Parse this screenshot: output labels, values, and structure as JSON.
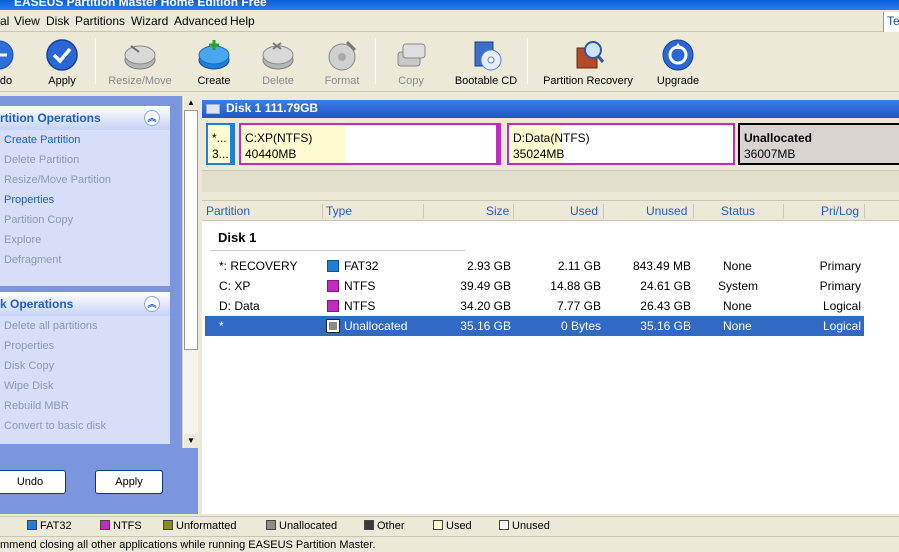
{
  "window": {
    "title": "EASEUS Partition Master Home Edition Free"
  },
  "menu": {
    "items": [
      "al",
      "View",
      "Disk",
      "Partitions",
      "Wizard",
      "Advanced",
      "Help"
    ],
    "right_tab": "Te"
  },
  "toolbar": {
    "buttons": [
      {
        "label": "do",
        "icon": "undo-icon",
        "enabled": true
      },
      {
        "label": "Apply",
        "icon": "apply-check-icon",
        "enabled": true
      },
      {
        "label": "Resize/Move",
        "icon": "resize-move-icon",
        "enabled": false
      },
      {
        "label": "Create",
        "icon": "create-partition-icon",
        "enabled": true
      },
      {
        "label": "Delete",
        "icon": "delete-partition-icon",
        "enabled": false
      },
      {
        "label": "Format",
        "icon": "format-icon",
        "enabled": false
      },
      {
        "label": "Copy",
        "icon": "copy-icon",
        "enabled": false
      },
      {
        "label": "Bootable CD",
        "icon": "bootable-cd-icon",
        "enabled": true
      },
      {
        "label": "Partition Recovery",
        "icon": "partition-recovery-icon",
        "enabled": true
      },
      {
        "label": "Upgrade",
        "icon": "upgrade-icon",
        "enabled": true
      }
    ]
  },
  "sidebar": {
    "partition_ops": {
      "title": "rtition Operations",
      "items": [
        {
          "label": "Create Partition",
          "enabled": true
        },
        {
          "label": "Delete Partition",
          "enabled": false
        },
        {
          "label": "Resize/Move Partition",
          "enabled": false
        },
        {
          "label": "Properties",
          "enabled": true
        },
        {
          "label": "Partition Copy",
          "enabled": false
        },
        {
          "label": "Explore",
          "enabled": false
        },
        {
          "label": "Defragment",
          "enabled": false
        }
      ]
    },
    "disk_ops": {
      "title": "k Operations",
      "items": [
        {
          "label": "Delete all partitions",
          "enabled": false
        },
        {
          "label": "Properties",
          "enabled": false
        },
        {
          "label": "Disk Copy",
          "enabled": false
        },
        {
          "label": "Wipe Disk",
          "enabled": false
        },
        {
          "label": "Rebuild MBR",
          "enabled": false
        },
        {
          "label": "Convert to basic disk",
          "enabled": false
        }
      ]
    },
    "undo_label": "Undo",
    "apply_label": "Apply"
  },
  "diskmap": {
    "disk_label": "Disk 1  111.79GB",
    "segments": [
      {
        "line1": "*...",
        "line2": "3..."
      },
      {
        "line1": "C:XP(NTFS)",
        "line2": "40440MB"
      },
      {
        "line1": "D:Data(NTFS)",
        "line2": "35024MB"
      },
      {
        "line1": "Unallocated",
        "line2": "36007MB"
      }
    ]
  },
  "table": {
    "headers": [
      "Partition",
      "Type",
      "Size",
      "Used",
      "Unused",
      "Status",
      "Pri/Log"
    ],
    "group": "Disk 1",
    "rows": [
      {
        "partition": "*: RECOVERY",
        "type": "FAT32",
        "size": "2.93 GB",
        "used": "2.11 GB",
        "unused": "843.49 MB",
        "status": "None",
        "prilog": "Primary"
      },
      {
        "partition": "C: XP",
        "type": "NTFS",
        "size": "39.49 GB",
        "used": "14.88 GB",
        "unused": "24.61 GB",
        "status": "System",
        "prilog": "Primary"
      },
      {
        "partition": "D: Data",
        "type": "NTFS",
        "size": "34.20 GB",
        "used": "7.77 GB",
        "unused": "26.43 GB",
        "status": "None",
        "prilog": "Logical"
      },
      {
        "partition": "*",
        "type": "Unallocated",
        "size": "35.16 GB",
        "used": "0 Bytes",
        "unused": "35.16 GB",
        "status": "None",
        "prilog": "Logical"
      }
    ]
  },
  "legend": {
    "items": [
      {
        "label": "FAT32",
        "color": "#1f7fd6"
      },
      {
        "label": "NTFS",
        "color": "#c02cc0"
      },
      {
        "label": "Unformatted",
        "color": "#8a8a1a"
      },
      {
        "label": "Unallocated",
        "color": "#8c8c8c"
      },
      {
        "label": "Other",
        "color": "#3a3a3a"
      },
      {
        "label": "Used",
        "color": "#fffbd0"
      },
      {
        "label": "Unused",
        "color": "#ffffff"
      }
    ]
  },
  "status": {
    "text": "mmend closing all other applications while running EASEUS Partition Master."
  },
  "colors": {
    "fat32": "#1f7fd6",
    "ntfs": "#c02cc0",
    "unallocated": "#8c8c8c",
    "used": "#fffbd0",
    "selection": "#316ac5"
  }
}
